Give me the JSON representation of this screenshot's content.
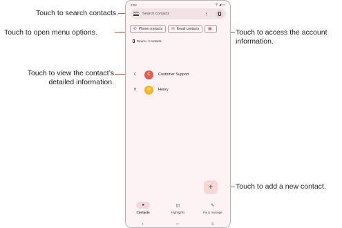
{
  "status_bar": {
    "time": "2:52",
    "signal": "ᯤ ◢ ▭"
  },
  "search": {
    "placeholder": "Search contacts",
    "menu_dots": "⋮"
  },
  "chips": [
    {
      "icon": "✆",
      "label": "Phone contacts"
    },
    {
      "icon": "✉",
      "label": "Email contacts"
    },
    {
      "icon": "▦",
      "label": ""
    }
  ],
  "device": {
    "label": "Device • 2 contacts"
  },
  "contacts": [
    {
      "letter": "C",
      "initial": "C",
      "name": "Customer Support",
      "color": "#e8594f"
    },
    {
      "letter": "H",
      "initial": "H",
      "name": "Henry",
      "color": "#f5b51c"
    }
  ],
  "fab": {
    "label": "+"
  },
  "nav": [
    {
      "label": "Contacts",
      "icon": "●"
    },
    {
      "label": "Highlights",
      "icon": "◫"
    },
    {
      "label": "Fix & manage",
      "icon": "✎"
    }
  ],
  "sys_nav": {
    "back": "‹",
    "home": "○",
    "recents": "≡"
  },
  "callouts": {
    "search": "Touch to search contacts.",
    "menu": "Touch to open menu options.",
    "account_line1": "Touch to access the account",
    "account_line2": "information.",
    "contact_line1": "Touch to view the contact’s",
    "contact_line2": "detailed information.",
    "add": "Touch to add a new contact."
  }
}
